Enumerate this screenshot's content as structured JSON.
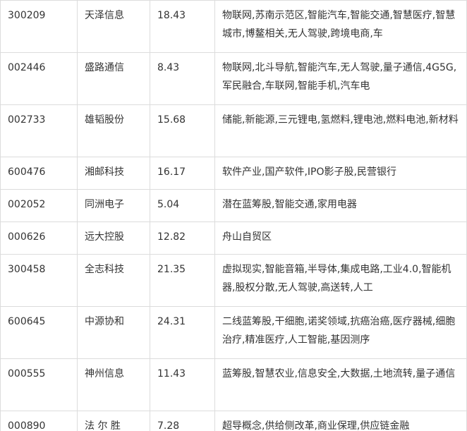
{
  "rows": [
    {
      "code": "300209",
      "name": "天泽信息",
      "price": "18.43",
      "concepts": "物联网,苏南示范区,智能汽车,智能交通,智慧医疗,智慧城市,博鳌相关,无人驾驶,跨境电商,车"
    },
    {
      "code": "002446",
      "name": "盛路通信",
      "price": "8.43",
      "concepts": "物联网,北斗导航,智能汽车,无人驾驶,量子通信,4G5G,军民融合,车联网,智能手机,汽车电"
    },
    {
      "code": "002733",
      "name": "雄韬股份",
      "price": "15.68",
      "concepts": "储能,新能源,三元锂电,氢燃料,锂电池,燃料电池,新材料"
    },
    {
      "code": "600476",
      "name": "湘邮科技",
      "price": "16.17",
      "concepts": "软件产业,国产软件,IPO影子股,民营银行"
    },
    {
      "code": "002052",
      "name": "同洲电子",
      "price": "5.04",
      "concepts": "潜在蓝筹股,智能交通,家用电器"
    },
    {
      "code": "000626",
      "name": "远大控股",
      "price": "12.82",
      "concepts": "舟山自贸区"
    },
    {
      "code": "300458",
      "name": "全志科技",
      "price": "21.35",
      "concepts": "虚拟现实,智能音箱,半导体,集成电路,工业4.0,智能机器,股权分散,无人驾驶,高送转,人工"
    },
    {
      "code": "600645",
      "name": "中源协和",
      "price": "24.31",
      "concepts": "二线蓝筹股,干细胞,诺奖领域,抗癌治癌,医疗器械,细胞治疗,精准医疗,人工智能,基因测序"
    },
    {
      "code": "000555",
      "name": "神州信息",
      "price": "11.43",
      "concepts": "蓝筹股,智慧农业,信息安全,大数据,土地流转,量子通信"
    },
    {
      "code": "000890",
      "name": "法 尔 胜",
      "price": "7.28",
      "concepts": "超导概念,供给侧改革,商业保理,供应链金融"
    }
  ]
}
